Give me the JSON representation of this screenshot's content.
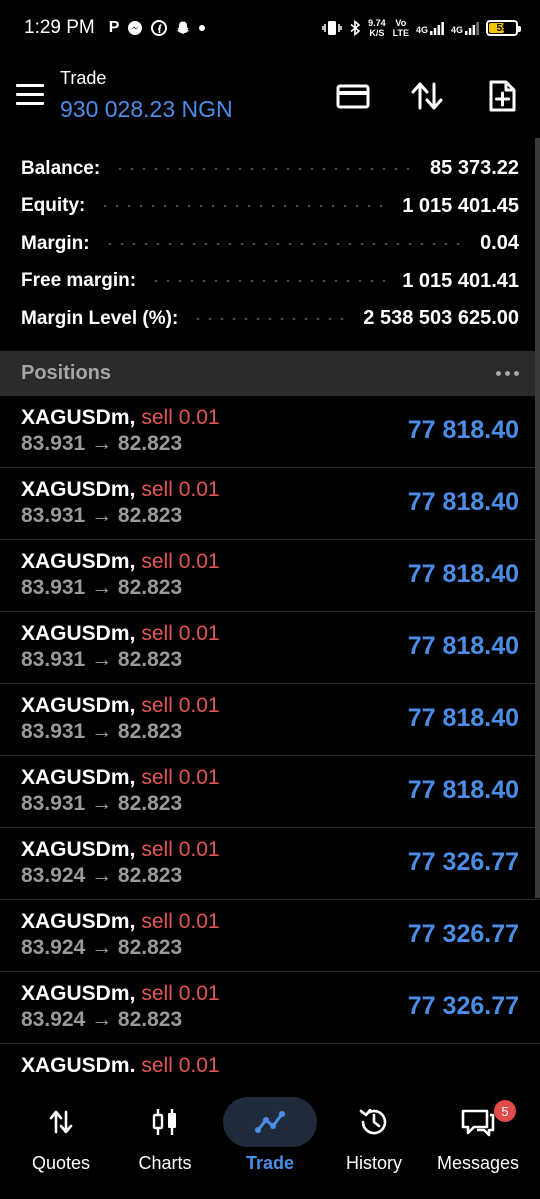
{
  "status_bar": {
    "time": "1:29 PM",
    "app_icons": [
      "P",
      "messenger",
      "facebook",
      "snapchat"
    ],
    "data_speed_value": "9.74",
    "data_speed_unit": "K/S",
    "volte_top": "Vo",
    "volte_bottom": "LTE",
    "network_1": "4G",
    "network_2": "4G",
    "battery_level": "59"
  },
  "header": {
    "title": "Trade",
    "balance": "930 028.23 NGN"
  },
  "summary": [
    {
      "label": "Balance:",
      "value": "85 373.22"
    },
    {
      "label": "Equity:",
      "value": "1 015 401.45"
    },
    {
      "label": "Margin:",
      "value": "0.04"
    },
    {
      "label": "Free margin:",
      "value": "1 015 401.41"
    },
    {
      "label": "Margin Level (%):",
      "value": "2 538 503 625.00"
    }
  ],
  "positions_header": {
    "label": "Positions"
  },
  "positions": [
    {
      "symbol": "XAGUSDm,",
      "side": "sell 0.01",
      "prices": "83.931 → 82.823",
      "profit": "77 818.40"
    },
    {
      "symbol": "XAGUSDm,",
      "side": "sell 0.01",
      "prices": "83.931 → 82.823",
      "profit": "77 818.40"
    },
    {
      "symbol": "XAGUSDm,",
      "side": "sell 0.01",
      "prices": "83.931 → 82.823",
      "profit": "77 818.40"
    },
    {
      "symbol": "XAGUSDm,",
      "side": "sell 0.01",
      "prices": "83.931 → 82.823",
      "profit": "77 818.40"
    },
    {
      "symbol": "XAGUSDm,",
      "side": "sell 0.01",
      "prices": "83.931 → 82.823",
      "profit": "77 818.40"
    },
    {
      "symbol": "XAGUSDm,",
      "side": "sell 0.01",
      "prices": "83.931 → 82.823",
      "profit": "77 818.40"
    },
    {
      "symbol": "XAGUSDm,",
      "side": "sell 0.01",
      "prices": "83.924 → 82.823",
      "profit": "77 326.77"
    },
    {
      "symbol": "XAGUSDm,",
      "side": "sell 0.01",
      "prices": "83.924 → 82.823",
      "profit": "77 326.77"
    },
    {
      "symbol": "XAGUSDm,",
      "side": "sell 0.01",
      "prices": "83.924 → 82.823",
      "profit": "77 326.77"
    },
    {
      "symbol": "XAGUSDm,",
      "side": "sell 0.01",
      "prices": "",
      "profit": ""
    }
  ],
  "bottom_nav": [
    {
      "label": "Quotes",
      "icon": "quotes-icon"
    },
    {
      "label": "Charts",
      "icon": "charts-icon"
    },
    {
      "label": "Trade",
      "icon": "trade-icon",
      "active": true
    },
    {
      "label": "History",
      "icon": "history-icon"
    },
    {
      "label": "Messages",
      "icon": "messages-icon",
      "badge": "5"
    }
  ],
  "colors": {
    "accent": "#4a8ee8",
    "sell": "#e35656",
    "background": "#000000",
    "section_header": "#2b2b2b"
  }
}
